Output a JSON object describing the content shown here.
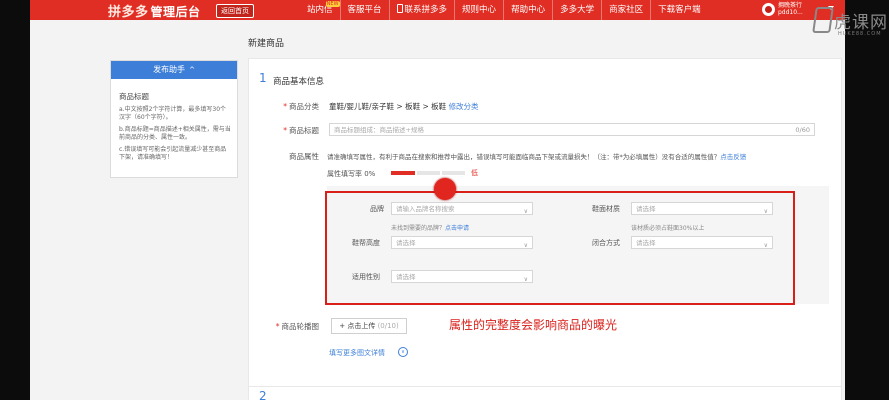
{
  "topbar": {
    "logo": "拼多多",
    "logo_sub": "管理后台",
    "home_button": "返回首页",
    "nav": [
      {
        "label": "站内信",
        "badge": "NEW"
      },
      {
        "label": "客服平台"
      },
      {
        "label": "联系拼多多"
      },
      {
        "label": "规则中心"
      },
      {
        "label": "帮助中心"
      },
      {
        "label": "多多大学"
      },
      {
        "label": "商家社区"
      },
      {
        "label": "下载客户端"
      }
    ],
    "user_name": "拥晚茶行",
    "user_id": "pdd10..."
  },
  "helper": {
    "title": "发布助手",
    "section": "商品标题",
    "tips": [
      "a.中文按照2个字符计算，最多填写30个汉字（60个字符）。",
      "b.商品标题=商品描述+相关属性，需与当前商品的分类、属性一致。",
      "c.错误填写可能会引起流量减少甚至商品下架，请准确填写！"
    ]
  },
  "main": {
    "page_title": "新建商品",
    "section_number": "1",
    "section_title": "商品基本信息",
    "category_label": "商品分类",
    "category_path": "童鞋/婴儿鞋/亲子鞋 > 板鞋 > 板鞋",
    "category_edit": "修改分类",
    "title_label": "商品标题",
    "title_placeholder": "商品标题组成：商品描述+规格",
    "title_counter": "0/60",
    "attr_label": "商品属性",
    "attr_note": "请准确填写属性，有利于商品在搜索和推荐中露出，错误填写可能面临商品下架或流量损失！（注：带*为必填属性）没有合适的属性值？",
    "attr_feedback": "点击反馈",
    "fill_rate_label": "属性填写率 0%",
    "fill_rate_level": "低",
    "fill_rate": 0.0,
    "attributes": [
      {
        "label": "品牌",
        "placeholder": "请输入品牌名称搜索",
        "hint": "未找到需要的品牌？",
        "hint_link": "点击申请"
      },
      {
        "label": "鞋面材质",
        "placeholder": "请选择",
        "hint": "该材质必须占鞋面30%以上"
      },
      {
        "label": "鞋帮高度",
        "placeholder": "请选择"
      },
      {
        "label": "闭合方式",
        "placeholder": "请选择"
      },
      {
        "label": "适用性别",
        "placeholder": "请选择"
      }
    ],
    "carousel_label": "商品轮播图",
    "upload_button": "+ 点击上传",
    "upload_count": "(0/10)",
    "more_link": "填写更多图文详情",
    "section2_number": "2"
  },
  "annotation": "属性的完整度会影响商品的曝光",
  "watermark": {
    "text": "虎课网",
    "sub": "HUKE88.COM"
  },
  "colors": {
    "brand_red": "#e02e24",
    "link_blue": "#3d7fd8",
    "highlight_red": "#d81f1a"
  }
}
